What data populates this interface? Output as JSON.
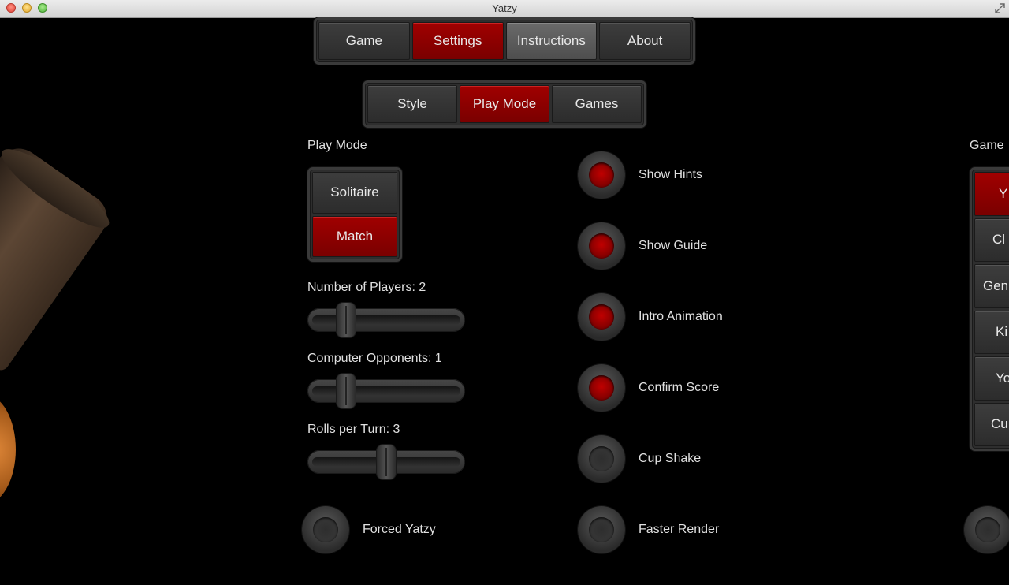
{
  "window": {
    "title": "Yatzy"
  },
  "main_tabs": [
    {
      "label": "Game",
      "state": "normal"
    },
    {
      "label": "Settings",
      "state": "active"
    },
    {
      "label": "Instructions",
      "state": "hover"
    },
    {
      "label": "About",
      "state": "normal"
    }
  ],
  "sub_tabs": [
    {
      "label": "Style",
      "state": "normal"
    },
    {
      "label": "Play Mode",
      "state": "active"
    },
    {
      "label": "Games",
      "state": "normal"
    }
  ],
  "play_mode": {
    "heading": "Play Mode",
    "options": [
      {
        "label": "Solitaire",
        "selected": false
      },
      {
        "label": "Match",
        "selected": true
      }
    ]
  },
  "sliders": [
    {
      "label": "Number of Players:  2",
      "value": 2,
      "min": 1,
      "max": 6
    },
    {
      "label": "Computer Opponents: 1",
      "value": 1,
      "min": 0,
      "max": 5
    },
    {
      "label": "Rolls per Turn:  3",
      "value": 3,
      "min": 1,
      "max": 5
    }
  ],
  "forced_yatzy": {
    "label": "Forced Yatzy",
    "on": false
  },
  "toggles": [
    {
      "label": "Show Hints",
      "on": true
    },
    {
      "label": "Show Guide",
      "on": true
    },
    {
      "label": "Intro Animation",
      "on": true
    },
    {
      "label": "Confirm Score",
      "on": true
    },
    {
      "label": "Cup Shake",
      "on": false
    },
    {
      "label": "Faster Render",
      "on": false
    }
  ],
  "game_type": {
    "heading": "Game",
    "options": [
      {
        "label": "Y",
        "selected": true
      },
      {
        "label": "Cl",
        "selected": false
      },
      {
        "label": "Gen",
        "selected": false
      },
      {
        "label": "Ki",
        "selected": false
      },
      {
        "label": "Yo",
        "selected": false
      },
      {
        "label": "Cu",
        "selected": false
      }
    ]
  },
  "colors": {
    "accent": "#9a0000",
    "background": "#000000",
    "control": "#2e2e2e"
  }
}
